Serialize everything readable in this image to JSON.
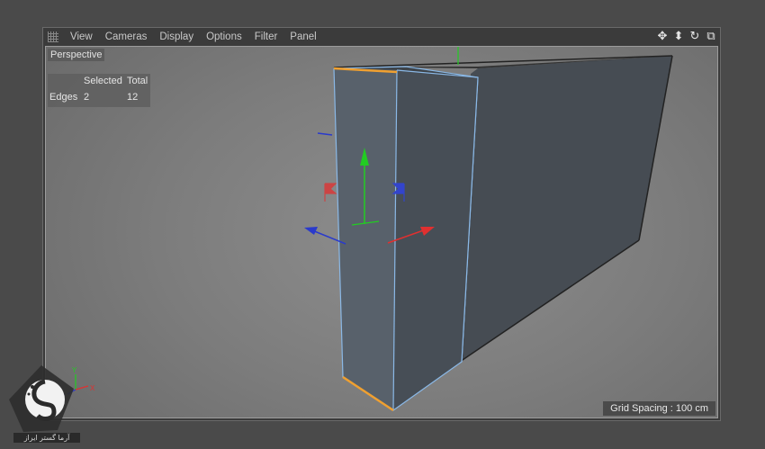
{
  "menu": {
    "items": [
      {
        "label": "View"
      },
      {
        "label": "Cameras"
      },
      {
        "label": "Display"
      },
      {
        "label": "Options"
      },
      {
        "label": "Filter"
      },
      {
        "label": "Panel"
      }
    ]
  },
  "nav_icons": [
    {
      "name": "move-view-icon",
      "glyph": "✥"
    },
    {
      "name": "dolly-view-icon",
      "glyph": "⬍"
    },
    {
      "name": "rotate-view-icon",
      "glyph": "↻"
    },
    {
      "name": "toggle-panel-icon",
      "glyph": "⧉"
    }
  ],
  "viewport": {
    "camera_label": "Perspective",
    "hud": {
      "header_selected": "Selected",
      "header_total": "Total",
      "row_label": "Edges",
      "selected_value": "2",
      "total_value": "12"
    },
    "grid_spacing": "Grid Spacing : 100 cm",
    "axis_labels": {
      "x": "X",
      "y": "Y",
      "z": "Z"
    }
  },
  "watermark": {
    "text": "آرما گستر ایراز"
  },
  "colors": {
    "background": "#4a4a4a",
    "viewport": "#7e7e7e",
    "object_face": "#4a525a",
    "selected_edge": "#f0a030",
    "highlight_edge": "#8ab8e6",
    "axis_x": "#e03030",
    "axis_y": "#22cc22",
    "axis_z": "#2a3acc"
  }
}
